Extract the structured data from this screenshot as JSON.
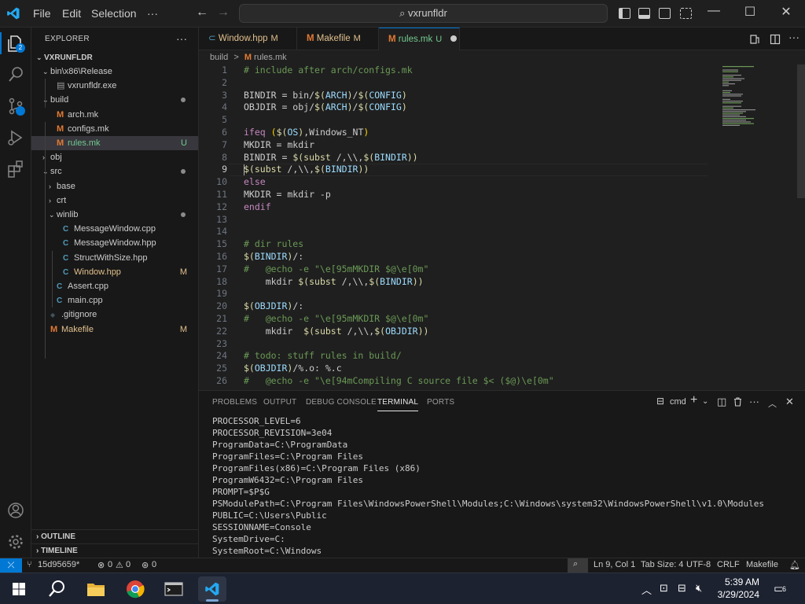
{
  "titlebar": {
    "menus": [
      "File",
      "Edit",
      "Selection",
      "···"
    ],
    "search": "vxrunfldr"
  },
  "activity": {
    "explorer_badge": "2"
  },
  "sidebar": {
    "title": "EXPLORER",
    "root": "VXRUNFLDR",
    "tree": [
      {
        "label": "bin\\x86\\Release",
        "type": "folder",
        "open": true,
        "depth": 1
      },
      {
        "label": "vxrunfldr.exe",
        "type": "file",
        "icon": "exe",
        "depth": 2
      },
      {
        "label": "build",
        "type": "folder",
        "open": true,
        "depth": 1,
        "dot": true
      },
      {
        "label": "arch.mk",
        "type": "file",
        "icon": "M",
        "depth": 2
      },
      {
        "label": "configs.mk",
        "type": "file",
        "icon": "M",
        "depth": 2
      },
      {
        "label": "rules.mk",
        "type": "file",
        "icon": "M",
        "depth": 2,
        "status": "U",
        "selected": true
      },
      {
        "label": "obj",
        "type": "folder",
        "open": false,
        "depth": 1
      },
      {
        "label": "src",
        "type": "folder",
        "open": true,
        "depth": 1,
        "dot": true
      },
      {
        "label": "base",
        "type": "folder",
        "open": false,
        "depth": 2
      },
      {
        "label": "crt",
        "type": "folder",
        "open": false,
        "depth": 2
      },
      {
        "label": "winlib",
        "type": "folder",
        "open": true,
        "depth": 2,
        "dot": true
      },
      {
        "label": "MessageWindow.cpp",
        "type": "file",
        "icon": "C",
        "depth": 3
      },
      {
        "label": "MessageWindow.hpp",
        "type": "file",
        "icon": "C",
        "depth": 3
      },
      {
        "label": "StructWithSize.hpp",
        "type": "file",
        "icon": "C",
        "depth": 3
      },
      {
        "label": "Window.hpp",
        "type": "file",
        "icon": "C",
        "depth": 3,
        "status": "M"
      },
      {
        "label": "Assert.cpp",
        "type": "file",
        "icon": "C",
        "depth": 2
      },
      {
        "label": "main.cpp",
        "type": "file",
        "icon": "C",
        "depth": 2
      },
      {
        "label": ".gitignore",
        "type": "file",
        "icon": "G",
        "depth": 1
      },
      {
        "label": "Makefile",
        "type": "file",
        "icon": "M",
        "depth": 1,
        "status": "M"
      }
    ],
    "outline": "OUTLINE",
    "timeline": "TIMELINE"
  },
  "tabs": [
    {
      "label": "Window.hpp",
      "status": "M",
      "icon": "C"
    },
    {
      "label": "Makefile",
      "status": "M",
      "icon": "M"
    },
    {
      "label": "rules.mk",
      "status": "U",
      "icon": "M",
      "active": true
    }
  ],
  "breadcrumb": {
    "folder": "build",
    "sep": ">",
    "file": "rules.mk"
  },
  "editor": {
    "current_line": 9,
    "lines": [
      {
        "n": "1",
        "html": "<span class=\"cmt\"># include after arch/configs.mk</span>"
      },
      {
        "n": "2",
        "html": ""
      },
      {
        "n": "3",
        "html": "BINDIR = bin/<span class=\"fn\">$(</span><span class=\"var\">ARCH</span><span class=\"fn\">)</span>/<span class=\"fn\">$(</span><span class=\"var\">CONFIG</span><span class=\"fn\">)</span>"
      },
      {
        "n": "4",
        "html": "OBJDIR = obj/<span class=\"fn\">$(</span><span class=\"var\">ARCH</span><span class=\"fn\">)</span>/<span class=\"fn\">$(</span><span class=\"var\">CONFIG</span><span class=\"fn\">)</span>"
      },
      {
        "n": "5",
        "html": ""
      },
      {
        "n": "6",
        "html": "<span class=\"kw\">ifeq</span> <span class=\"br1\">(</span><span class=\"fn\">$(</span><span class=\"var\">OS</span><span class=\"fn\">)</span>,Windows_NT<span class=\"br1\">)</span>"
      },
      {
        "n": "7",
        "html": "MKDIR = mkdir"
      },
      {
        "n": "8",
        "html": "BINDIR = <span class=\"fn\">$(</span><span class=\"fn\">subst</span> /,\\\\,<span class=\"fn\">$(</span><span class=\"var\">BINDIR</span><span class=\"fn\">))</span>"
      },
      {
        "n": "9",
        "html": "<span class=\"fn\">$(</span><span class=\"fn\">subst</span> /,\\\\,<span class=\"fn\">$(</span><span class=\"var\">BINDIR</span><span class=\"fn\">))</span>"
      },
      {
        "n": "10",
        "html": "<span class=\"kw\">else</span>"
      },
      {
        "n": "11",
        "html": "MKDIR = mkdir -p"
      },
      {
        "n": "12",
        "html": "<span class=\"kw\">endif</span>"
      },
      {
        "n": "13",
        "html": ""
      },
      {
        "n": "14",
        "html": ""
      },
      {
        "n": "15",
        "html": "<span class=\"cmt\"># dir rules</span>"
      },
      {
        "n": "16",
        "html": "<span class=\"fn\">$(</span><span class=\"var\">BINDIR</span><span class=\"fn\">)</span>/:"
      },
      {
        "n": "17",
        "html": "<span class=\"cmt\">#   @echo -e \"\\e[95mMKDIR $@\\e[0m\"</span>"
      },
      {
        "n": "18",
        "html": "    mkdir <span class=\"fn\">$(</span><span class=\"fn\">subst</span> /,\\\\,<span class=\"fn\">$(</span><span class=\"var\">BINDIR</span><span class=\"fn\">))</span>"
      },
      {
        "n": "19",
        "html": ""
      },
      {
        "n": "20",
        "html": "<span class=\"fn\">$(</span><span class=\"var\">OBJDIR</span><span class=\"fn\">)</span>/:"
      },
      {
        "n": "21",
        "html": "<span class=\"cmt\">#   @echo -e \"\\e[95mMKDIR $@\\e[0m\"</span>"
      },
      {
        "n": "22",
        "html": "    mkdir  <span class=\"fn\">$(</span><span class=\"fn\">subst</span> /,\\\\,<span class=\"fn\">$(</span><span class=\"var\">OBJDIR</span><span class=\"fn\">))</span>"
      },
      {
        "n": "23",
        "html": ""
      },
      {
        "n": "24",
        "html": "<span class=\"cmt\"># todo: stuff rules in build/</span>"
      },
      {
        "n": "25",
        "html": "<span class=\"fn\">$(</span><span class=\"var\">OBJDIR</span><span class=\"fn\">)</span>/%.o: %.c"
      },
      {
        "n": "26",
        "html": "<span class=\"cmt\">#   @echo -e \"\\e[94mCompiling C source file $&lt; ($@)\\e[0m\"</span>"
      }
    ]
  },
  "panel": {
    "tabs": [
      "PROBLEMS",
      "OUTPUT",
      "DEBUG CONSOLE",
      "TERMINAL",
      "PORTS"
    ],
    "active_tab": "TERMINAL",
    "shell": "cmd",
    "terminal_lines": [
      "PROCESSOR_LEVEL=6",
      "PROCESSOR_REVISION=3e04",
      "ProgramData=C:\\ProgramData",
      "ProgramFiles=C:\\Program Files",
      "ProgramFiles(x86)=C:\\Program Files (x86)",
      "ProgramW6432=C:\\Program Files",
      "PROMPT=$P$G",
      "PSModulePath=C:\\Program Files\\WindowsPowerShell\\Modules;C:\\Windows\\system32\\WindowsPowerShell\\v1.0\\Modules",
      "PUBLIC=C:\\Users\\Public",
      "SESSIONNAME=Console",
      "SystemDrive=C:",
      "SystemRoot=C:\\Windows"
    ]
  },
  "statusbar": {
    "branch": "15d95659*",
    "errors": "0",
    "warnings": "0",
    "ports": "0",
    "position": "Ln 9, Col 1",
    "tabsize": "Tab Size: 4",
    "encoding": "UTF-8",
    "eol": "CRLF",
    "language": "Makefile"
  },
  "taskbar": {
    "time": "5:39 AM",
    "date": "3/29/2024",
    "notifications": "6"
  },
  "colors": {
    "accent": "#0078d4",
    "modified": "#e2c08d",
    "untracked": "#73c991"
  }
}
